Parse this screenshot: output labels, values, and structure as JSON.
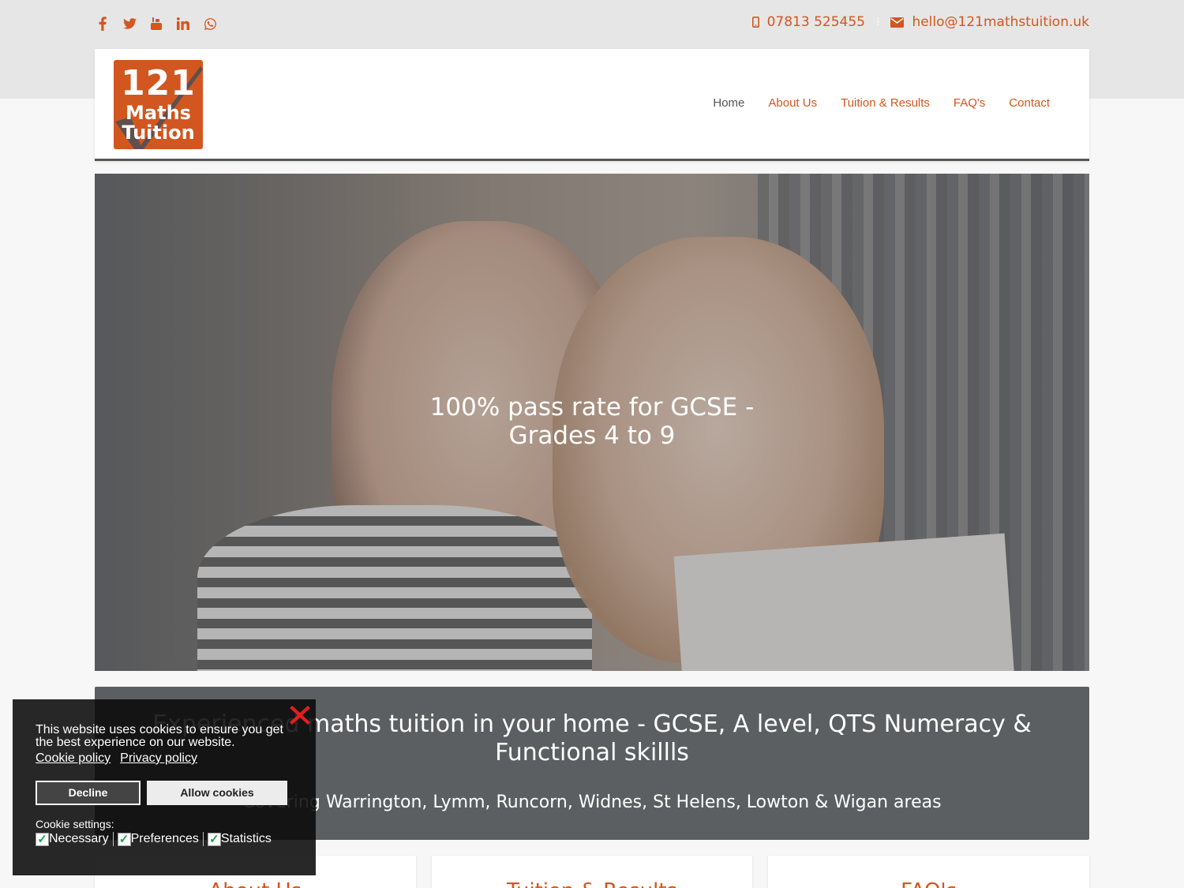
{
  "topbar": {
    "social": [
      "facebook-icon",
      "twitter-icon",
      "youtube-icon",
      "linkedin-icon",
      "whatsapp-icon"
    ],
    "phone": "07813 525455",
    "email": "hello@121mathstuition.uk"
  },
  "logo": {
    "line1": "121",
    "line2": "Maths",
    "line3": "Tuition"
  },
  "nav": {
    "home": "Home",
    "about": "About Us",
    "tuition": "Tuition & Results",
    "faq": "FAQ's",
    "contact": "Contact"
  },
  "hero": {
    "title": "100% pass rate for GCSE -\nGrades 4 to 9"
  },
  "banner": {
    "heading": "Experienced maths tuition in your home - GCSE, A level, QTS Numeracy & Functional skillls",
    "subheading": "Covering Warrington, Lymm, Runcorn, Widnes, St Helens, Lowton & Wigan areas"
  },
  "cards": [
    "About Us",
    "Tuition & Results",
    "FAQ's"
  ],
  "cookie": {
    "message": "This website uses cookies to ensure you get the best experience on our website.",
    "cookie_policy": "Cookie policy",
    "privacy_policy": "Privacy policy",
    "decline": "Decline",
    "allow": "Allow cookies",
    "settings_label": "Cookie settings:",
    "necessary": "Necessary",
    "preferences": "Preferences",
    "statistics": "Statistics"
  },
  "colors": {
    "accent": "#d2561f",
    "banner": "#5c5f61",
    "text": "#555555"
  }
}
